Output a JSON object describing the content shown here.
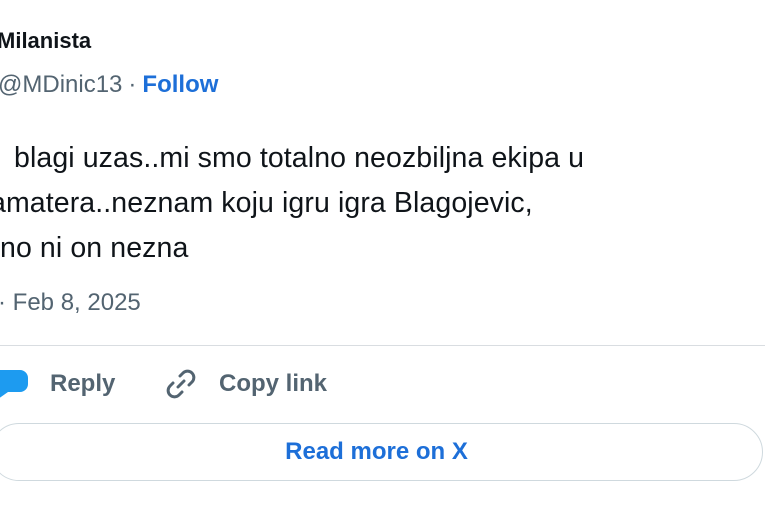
{
  "author": {
    "name": "Milanista",
    "handle": "@MDinic13",
    "separator": "·",
    "follow_label": "Follow"
  },
  "tweet": {
    "lines": [
      "blagi uzas..mi smo totalno neozbiljna ekipa u",
      "amatera..neznam koju igru igra Blagojevic,",
      "tno ni on nezna"
    ],
    "date_prefix": "·",
    "date": "Feb 8, 2025"
  },
  "actions": {
    "reply_label": "Reply",
    "copy_link_label": "Copy link",
    "reply_icon": "reply-bubble-icon",
    "copy_icon": "link-icon"
  },
  "read_more_label": "Read more on X",
  "colors": {
    "accent": "#1d6fd8",
    "reply_icon": "#1d9bf0",
    "muted": "#536471",
    "text": "#0f1419"
  }
}
